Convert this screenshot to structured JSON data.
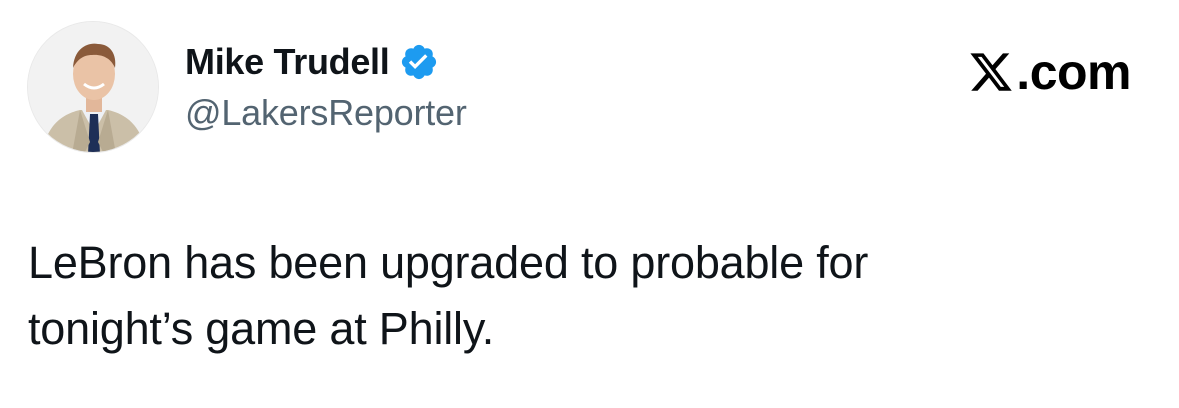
{
  "author": {
    "display_name": "Mike Trudell",
    "handle": "@LakersReporter",
    "verified": true,
    "avatar_icon": "profile-photo-man-in-suit"
  },
  "brand": {
    "icon": "x-logo-icon",
    "suffix": ".com"
  },
  "tweet": {
    "text": "LeBron has been upgraded to probable for\ntonight’s game at Philly."
  },
  "colors": {
    "verified_badge": "#1d9bf0",
    "handle": "#536471",
    "text": "#0f1419",
    "background": "#ffffff"
  }
}
